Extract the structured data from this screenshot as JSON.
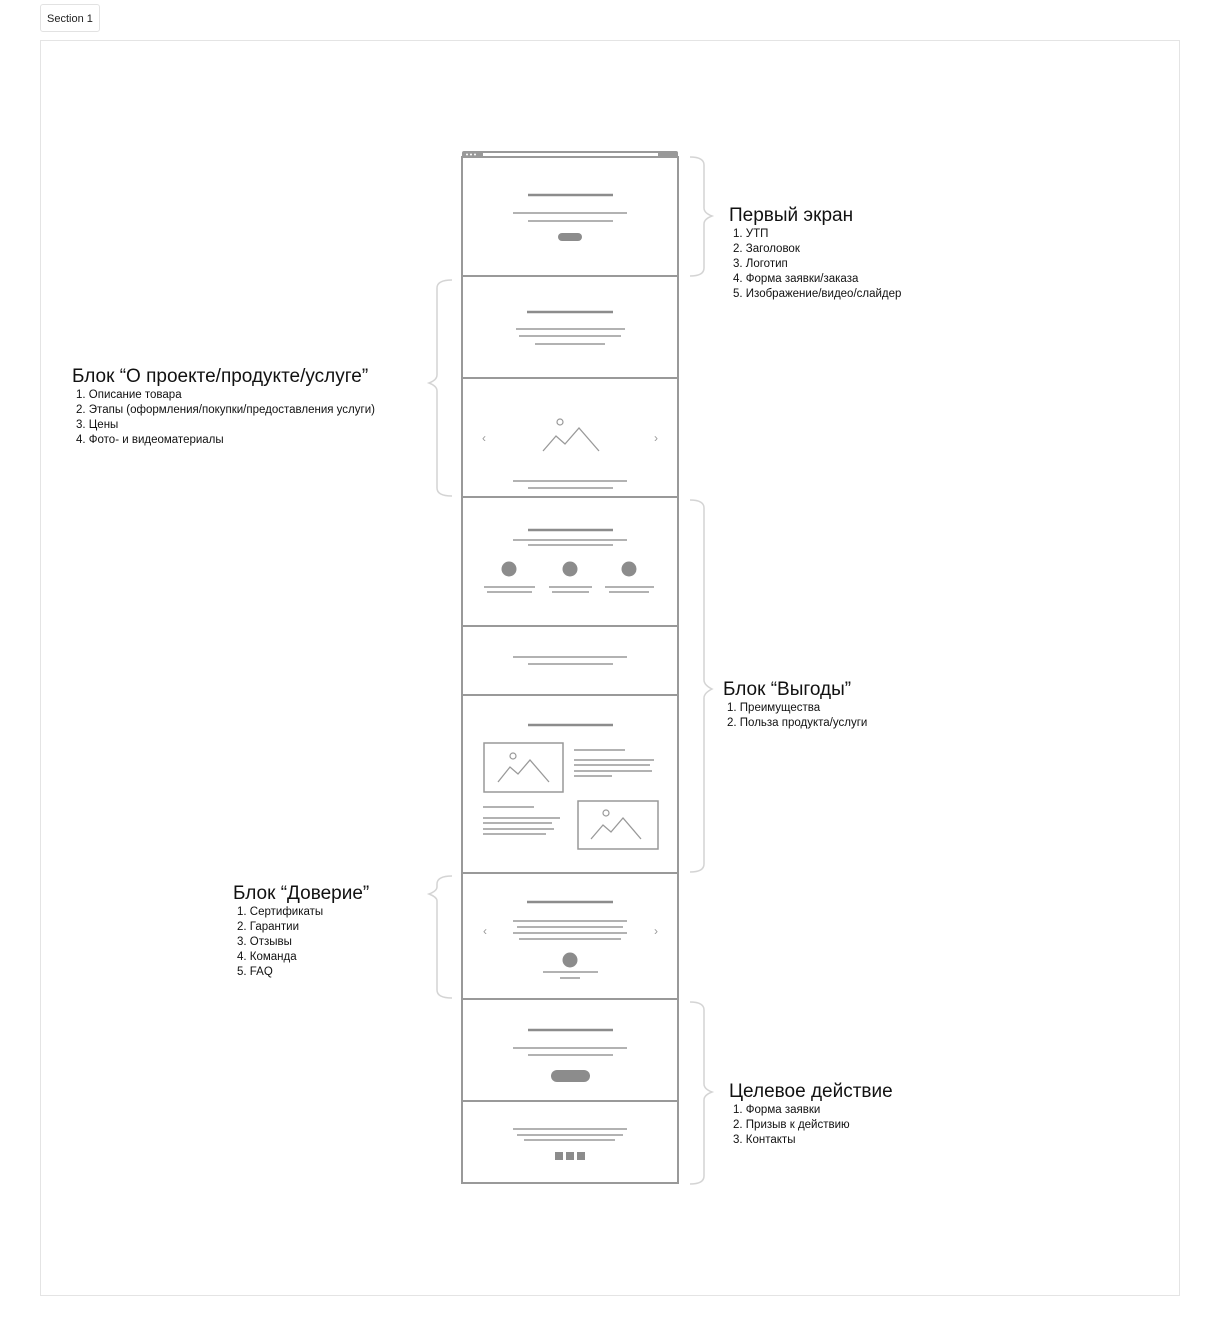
{
  "section_tab": "Section 1",
  "colors": {
    "wire": "#999999",
    "wire_dark": "#8c8c8c",
    "bracket": "#d4d4d4",
    "frame_border": "#e4e4e4"
  },
  "blocks": [
    {
      "title": "Первый экран",
      "items": [
        "1. УТП",
        "2. Заголовок",
        "3. Логотип",
        "4. Форма заявки/заказа",
        "5. Изображение/видео/слайдер"
      ],
      "side": "right"
    },
    {
      "title": "Блок “О проекте/продукте/услуге”",
      "items": [
        "1. Описание товара",
        "2. Этапы (оформления/покупки/предоставления услуги)",
        "3. Цены",
        "4. Фото- и видеоматериалы"
      ],
      "side": "left"
    },
    {
      "title": "Блок “Выгоды”",
      "items": [
        "1. Преимущества",
        "2. Польза продукта/услуги"
      ],
      "side": "right"
    },
    {
      "title": "Блок “Доверие”",
      "items": [
        "1. Сертификаты",
        "2. Гарантии",
        "3. Отзывы",
        "4. Команда",
        "5. FAQ"
      ],
      "side": "left"
    },
    {
      "title": "Целевое действие",
      "items": [
        "1. Форма заявки",
        "2. Призыв к действию",
        "3. Контакты"
      ],
      "side": "right"
    }
  ],
  "wireframe": {
    "sections": [
      "hero",
      "about-text",
      "gallery-slider",
      "features",
      "text-strip",
      "media-text",
      "testimonials-slider",
      "cta-form",
      "footer"
    ],
    "slider_prev_icon": "‹",
    "slider_next_icon": "›"
  }
}
